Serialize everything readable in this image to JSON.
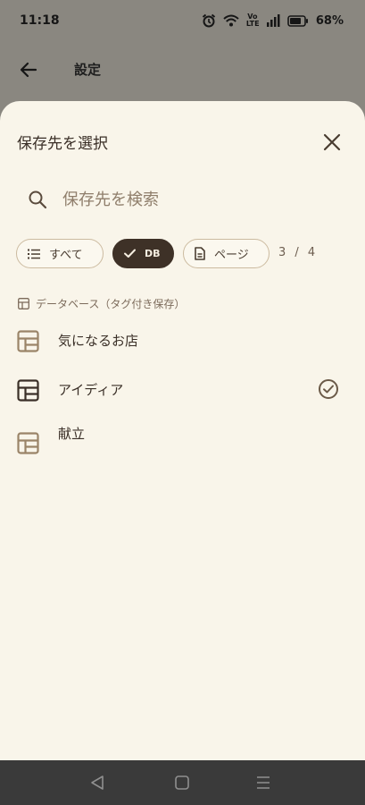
{
  "status_bar": {
    "time": "11:18",
    "network": "Vo LTE",
    "battery": "68%"
  },
  "header": {
    "title": "設定"
  },
  "sheet": {
    "title": "保存先を選択",
    "search_placeholder": "保存先を検索",
    "filters": [
      {
        "label": "すべて",
        "icon": "list-icon",
        "active": false
      },
      {
        "label": "DB",
        "icon": "check-icon",
        "active": true
      },
      {
        "label": "ページ",
        "icon": "document-icon",
        "active": false
      }
    ],
    "counter": "3 / 4",
    "section_label": "データベース（タグ付き保存）",
    "items": [
      {
        "label": "気になるお店",
        "icon": "table-icon",
        "selected": false
      },
      {
        "label": "アイディア",
        "icon": "table-icon",
        "selected": true
      },
      {
        "label": "献立",
        "icon": "table-icon",
        "selected": false
      }
    ]
  },
  "colors": {
    "sheet_bg": "#f9f5ea",
    "accent_dark": "#3e3127",
    "chip_border": "#ccbba0",
    "scrim": "#8a8780",
    "nav_bg": "#3a3a3a"
  }
}
